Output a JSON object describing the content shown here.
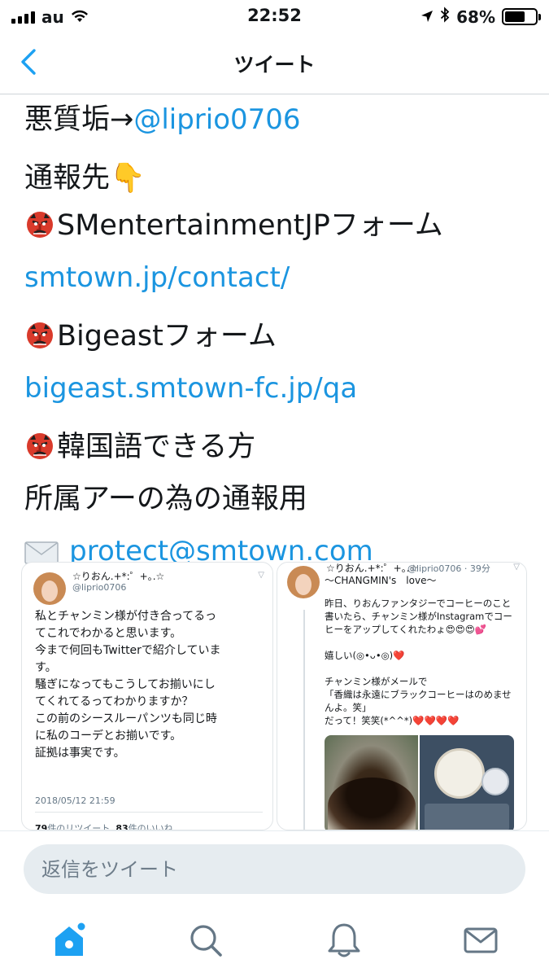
{
  "status_bar": {
    "carrier": "au",
    "time": "22:52",
    "battery_percent": "68%",
    "battery_level": 0.68,
    "icons": [
      "signal-icon",
      "wifi-icon",
      "location-icon",
      "bluetooth-icon",
      "battery-icon"
    ]
  },
  "nav": {
    "title": "ツイート",
    "back_icon": "chevron-left-icon"
  },
  "tweet": {
    "line1_prefix": "悪質垢→",
    "line1_link": "@liprio0706",
    "line2": "通報先👇",
    "line3": "SMentertainmentJPフォーム",
    "line4_link": "smtown.jp/contact/",
    "line5": "Bigeastフォーム",
    "line6_link": "bigeast.smtown-fc.jp/qa",
    "line7": "韓国語できる方",
    "line8": "所属アーの為の通報用",
    "line9_link": "protect@smtown.com",
    "icons": [
      "pointing-down-icon",
      "tengu-mask-icon",
      "envelope-icon"
    ]
  },
  "screenshot_left": {
    "name": "☆りおん.+*:゜+｡.☆",
    "handle": "@liprio0706",
    "text": "私とチャンミン様が付き合ってるっ\nてこれでわかると思います。\n今まで何回もTwitterで紹介していま\nす。\n騒ぎになってもこうしてお揃いにし\nてくれてるってわかりますか？\nこの前のシースルーパンツも同じ時\nに私のコーデとお揃いです。\n証拠は事実です。",
    "date": "2018/05/12 21:59",
    "retweets_count": "79",
    "retweets_label": "件のリツイート",
    "likes_count": "83",
    "likes_label": "件のいいね"
  },
  "screenshot_right": {
    "name": "☆りおん.+*:゜+｡.☆",
    "handle_time": "@liprio0706 · 39分",
    "subtitle": "〜CHANGMIN's　love〜",
    "text": "昨日、りおんファンタジーでコーヒーのこと\n書いたら、チャンミン様がInstagramでコー\nヒーをアップしてくれたわょ😍😍😍💕\n\n嬉しい(◎•ᴗ•◎)❤️\n\nチャンミン様がメールで\n「香織は永遠にブラックコーヒーはのめませ\nんよ。笑」\nだって！笑笑(*^^*)❤️❤️❤️❤️"
  },
  "reply": {
    "placeholder": "返信をツイート"
  },
  "tabbar": {
    "items": [
      "home-icon",
      "search-icon",
      "notifications-icon",
      "messages-icon"
    ],
    "active_color": "#1da1f2",
    "inactive_color": "#657786"
  },
  "colors": {
    "link": "#1b95e0",
    "text": "#14171a"
  }
}
